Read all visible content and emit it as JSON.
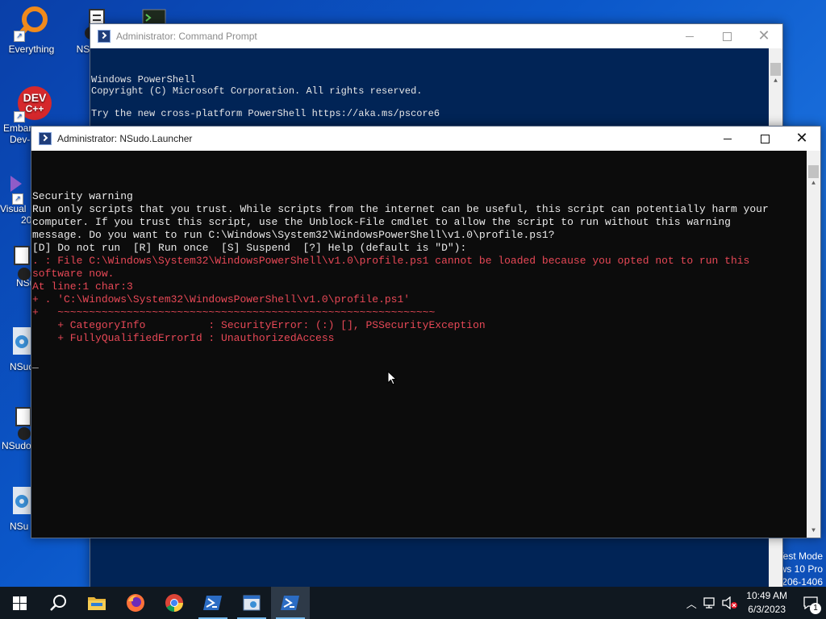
{
  "desktop": {
    "icons": [
      {
        "label": "Everything"
      },
      {
        "label": "NSudo"
      },
      {
        "label": "Embar"
      },
      {
        "label": "Dev-"
      },
      {
        "label": "Visual"
      },
      {
        "label": "20"
      },
      {
        "label": "NSu"
      },
      {
        "label": "NSud"
      },
      {
        "label": "NSudo"
      },
      {
        "label": "NSu"
      }
    ],
    "watermark": {
      "line1": "Test Mode",
      "line2": "ws 10 Pro",
      "line3": "206-1406"
    }
  },
  "back_window": {
    "title": "Administrator:  Command Prompt",
    "lines": [
      "Windows PowerShell",
      "Copyright (C) Microsoft Corporation. All rights reserved.",
      "",
      "Try the new cross-platform PowerShell https://aka.ms/pscore6",
      "",
      "",
      "Security warning"
    ]
  },
  "front_window": {
    "title": "Administrator: NSudo.Launcher",
    "lines": [
      {
        "text": "Security warning",
        "color": "white"
      },
      {
        "text": "Run only scripts that you trust. While scripts from the internet can be useful, this script can potentially harm your",
        "color": "white"
      },
      {
        "text": "computer. If you trust this script, use the Unblock-File cmdlet to allow the script to run without this warning",
        "color": "white"
      },
      {
        "text": "message. Do you want to run C:\\Windows\\System32\\WindowsPowerShell\\v1.0\\profile.ps1?",
        "color": "white"
      },
      {
        "text": "[D] Do not run  [R] Run once  [S] Suspend  [?] Help (default is \"D\"):",
        "color": "white"
      },
      {
        "text": ". : File C:\\Windows\\System32\\WindowsPowerShell\\v1.0\\profile.ps1 cannot be loaded because you opted not to run this",
        "color": "red"
      },
      {
        "text": "software now.",
        "color": "red"
      },
      {
        "text": "At line:1 char:3",
        "color": "red"
      },
      {
        "text": "+ . 'C:\\Windows\\System32\\WindowsPowerShell\\v1.0\\profile.ps1'",
        "color": "red"
      },
      {
        "text": "+   ~~~~~~~~~~~~~~~~~~~~~~~~~~~~~~~~~~~~~~~~~~~~~~~~~~~~~~~~~~~~",
        "color": "red"
      },
      {
        "text": "    + CategoryInfo          : SecurityError: (:) [], PSSecurityException",
        "color": "red"
      },
      {
        "text": "    + FullyQualifiedErrorId : UnauthorizedAccess",
        "color": "red"
      },
      {
        "text": "",
        "color": "white"
      },
      {
        "text": "_",
        "color": "white"
      }
    ]
  },
  "taskbar": {
    "apps": [
      {
        "name": "start",
        "icon": "windows-logo-icon"
      },
      {
        "name": "search",
        "icon": "search-icon"
      },
      {
        "name": "file-explorer",
        "icon": "folder-icon"
      },
      {
        "name": "firefox",
        "icon": "firefox-icon"
      },
      {
        "name": "chrome",
        "icon": "chrome-icon"
      },
      {
        "name": "powershell",
        "icon": "powershell-icon"
      },
      {
        "name": "nsudo",
        "icon": "nsudo-icon"
      },
      {
        "name": "powershell-active",
        "icon": "powershell-icon"
      }
    ],
    "clock": {
      "time": "10:49 AM",
      "date": "6/3/2023"
    },
    "notification_count": "1"
  },
  "colors": {
    "desktop": "#0b57c9",
    "back_console_bg": "#012456",
    "front_console_bg": "#0c0c0c",
    "error_text": "#e74856"
  }
}
